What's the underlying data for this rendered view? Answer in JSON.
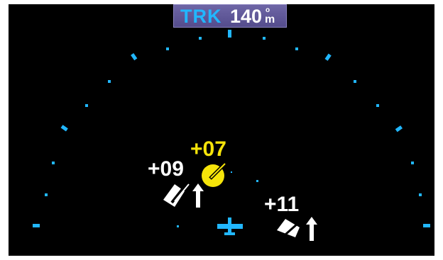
{
  "header": {
    "label": "TRK",
    "value": "140",
    "degree_mark": "o",
    "unit": "m"
  },
  "traffic": [
    {
      "altitude": "+07",
      "color": "#f6e40a",
      "symbol": "proximate-traffic-circle"
    },
    {
      "altitude": "+09",
      "color": "#ffffff",
      "symbol": "traffic-arrow-climbing"
    },
    {
      "altitude": "+11",
      "color": "#ffffff",
      "symbol": "traffic-arrow-climbing"
    }
  ],
  "colors": {
    "background": "#000000",
    "range_ring": "#21b7ff",
    "traffic_advisory": "#f6e40a",
    "traffic_other": "#ffffff"
  }
}
